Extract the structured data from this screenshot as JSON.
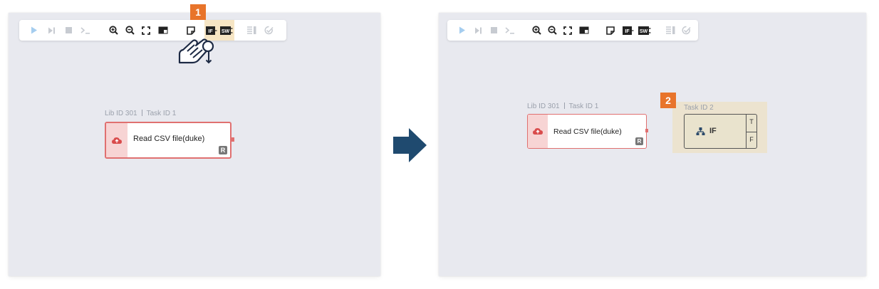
{
  "steps": {
    "step1": "1",
    "step2": "2"
  },
  "left": {
    "node_header": {
      "lib_id": "Lib ID 301",
      "task_id": "Task ID 1"
    },
    "node": {
      "title": "Read CSV file(duke)",
      "badge": "R"
    }
  },
  "right": {
    "node_header": {
      "lib_id": "Lib ID 301",
      "task_id": "Task ID 1"
    },
    "node": {
      "title": "Read CSV file(duke)",
      "badge": "R"
    },
    "if_header": "Task ID 2",
    "if_node": {
      "label": "IF",
      "true_port": "T",
      "false_port": "F"
    }
  },
  "toolbar": {
    "icons": [
      "play-icon",
      "step-forward-icon",
      "stop-icon",
      "terminal-icon",
      "zoom-in-icon",
      "zoom-out-icon",
      "fit-screen-icon",
      "minimap-icon",
      "note-icon",
      "if-icon",
      "switch-icon",
      "list-icon",
      "validate-icon"
    ],
    "if_text": "IF",
    "sw_text": "SW"
  },
  "colors": {
    "canvas": "#e8e9ef",
    "accent_orange": "#e8742b",
    "node_border": "#e07070",
    "play_disabled": "#9cc8ee",
    "arrow": "#1f4a6f"
  }
}
